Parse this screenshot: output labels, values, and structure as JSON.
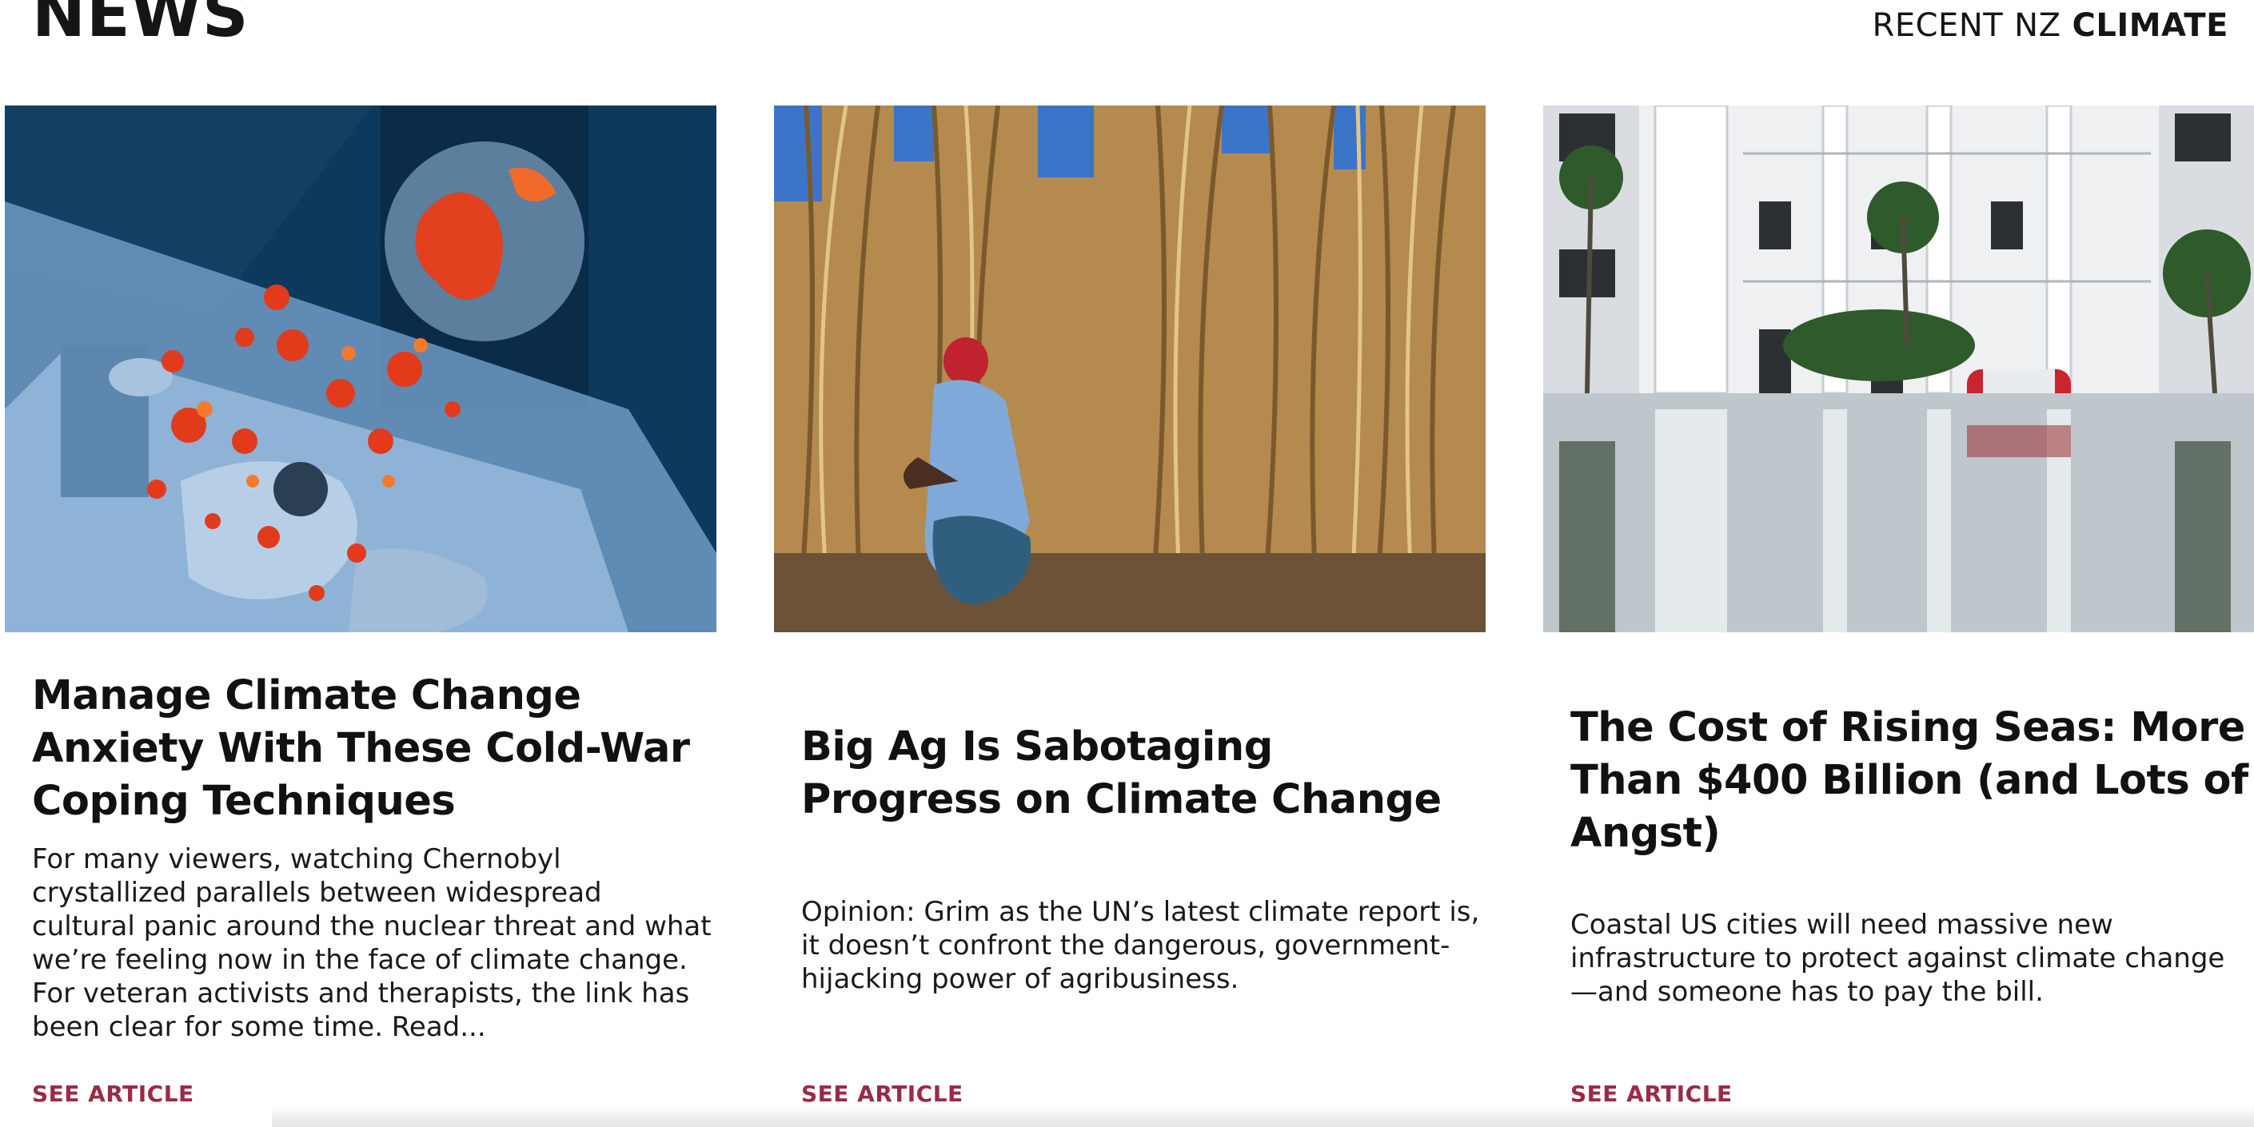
{
  "page": {
    "title": "NEWS",
    "nav": {
      "recent": "RECENT",
      "nz": "NZ",
      "climate": "CLIMATE"
    }
  },
  "colors": {
    "link": "#9c2a45",
    "text": "#111111"
  },
  "articles": [
    {
      "image_icon": "illustration-climate-anxiety-bed",
      "title": "Manage Climate Change Anxiety With These Cold-War Coping Techniques",
      "description": "For many viewers, watching Chernobyl crystallized parallels between widespread cultural panic around the nuclear threat and what we’re feeling now in the face of climate change. For veteran activists and therapists, the link has been clear for some time. Read...",
      "link_label": "SEE ARTICLE"
    },
    {
      "image_icon": "photo-dry-corn-field",
      "title": "Big Ag Is Sabotaging Progress on Climate Change",
      "description": "Opinion: Grim as the UN’s latest climate report is, it doesn’t confront the dangerous, government-hijacking power of agribusiness.",
      "link_label": "SEE ARTICLE"
    },
    {
      "image_icon": "photo-flooded-apartments",
      "title": "The Cost of Rising Seas: More Than $400 Billion (and Lots of Angst)",
      "description": "Coastal US cities will need massive new infrastructure to protect against climate change—and someone has to pay the bill.",
      "link_label": "SEE ARTICLE"
    }
  ]
}
